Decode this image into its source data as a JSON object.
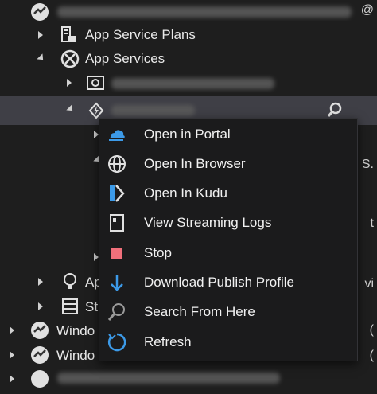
{
  "tree": {
    "rows": [
      {
        "label": ""
      },
      {
        "label": "App Service Plans"
      },
      {
        "label": "App Services"
      },
      {
        "label": ""
      },
      {
        "label": ""
      },
      {
        "label": "Ap"
      },
      {
        "label": "St"
      },
      {
        "label": "Windo"
      },
      {
        "label": "Windo"
      },
      {
        "label": ""
      }
    ],
    "edge_text": [
      "S.",
      "t",
      "vi",
      "(",
      "("
    ]
  },
  "context_menu": {
    "items": [
      {
        "label": "Open in Portal",
        "icon": "portal-icon"
      },
      {
        "label": "Open In Browser",
        "icon": "globe-icon"
      },
      {
        "label": "Open In Kudu",
        "icon": "kudu-icon"
      },
      {
        "label": "View Streaming Logs",
        "icon": "log-icon"
      },
      {
        "label": "Stop",
        "icon": "stop-icon"
      },
      {
        "label": "Download Publish Profile",
        "icon": "download-icon"
      },
      {
        "label": "Search From Here",
        "icon": "search-icon"
      },
      {
        "label": "Refresh",
        "icon": "refresh-icon"
      }
    ]
  },
  "colors": {
    "background": "#1e1e1e",
    "menu": "#1b1b1c",
    "selected": "#3f3f46",
    "stop": "#f1707b",
    "accent": "#3c9ae8"
  }
}
